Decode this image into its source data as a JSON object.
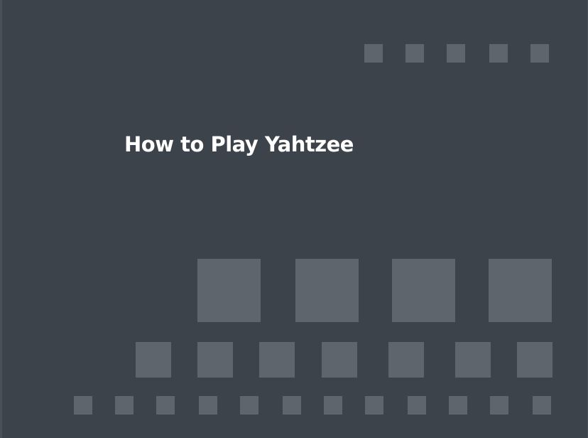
{
  "page": {
    "title": "How to Play Yahtzee"
  },
  "decoration": {
    "square_color": "#5e656c",
    "background_color": "#3d434a",
    "square_rows": [
      {
        "name": "top-small-row",
        "count": 5
      },
      {
        "name": "large-row",
        "count": 4
      },
      {
        "name": "medium-row",
        "count": 7
      },
      {
        "name": "bottom-small-row",
        "count": 12
      }
    ]
  }
}
